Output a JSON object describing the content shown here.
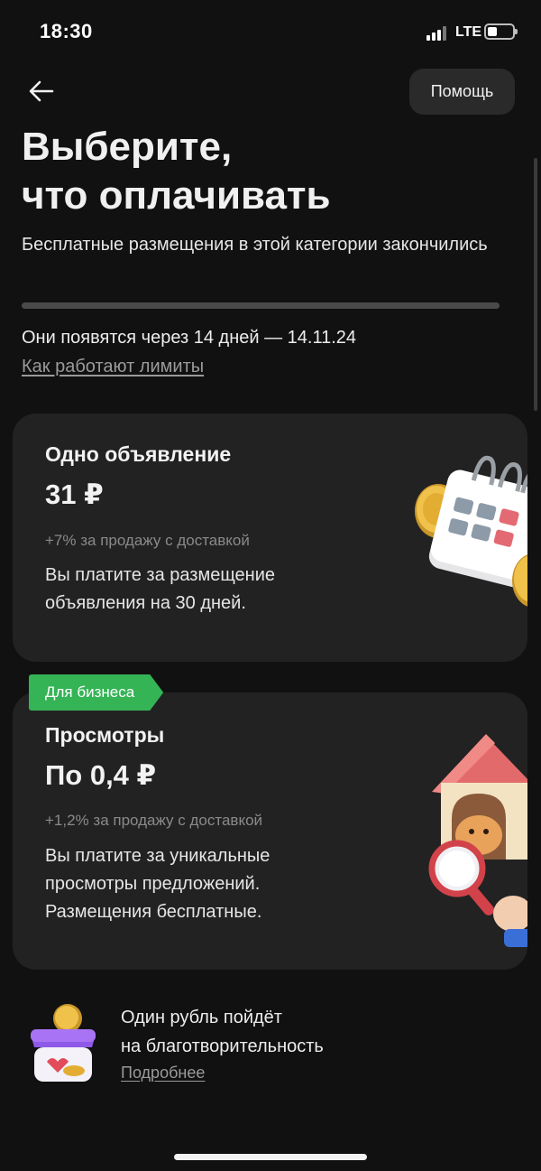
{
  "status_bar": {
    "time": "18:30",
    "network": "LTE",
    "battery_level": 0.3
  },
  "header": {
    "back_icon": "arrow-left-icon",
    "help_label": "Помощь"
  },
  "title": {
    "line1": "Выберите,",
    "line2": "что оплачивать"
  },
  "subtitle": "Бесплатные размещения в этой категории закончились",
  "limits": {
    "used_fraction": 1.0,
    "reset_text": "Они появятся через 14 дней — 14.11.24",
    "link_label": "Как работают лимиты"
  },
  "options": [
    {
      "title": "Одно объявление",
      "price": "31 ₽",
      "fee": "+7% за продажу с доставкой",
      "description": "Вы платите за размещение объявления на 30 дней.",
      "illustration": "calendar-coins-icon"
    },
    {
      "badge": "Для бизнеса",
      "title": "Просмотры",
      "price": "По 0,4 ₽",
      "fee": "+1,2% за продажу с доставкой",
      "description": "Вы платите за уникальные просмотры предложений. Размещения бесплатные.",
      "illustration": "doghouse-magnifier-icon"
    }
  ],
  "charity": {
    "line1": "Один рубль пойдёт",
    "line2": "на благотворительность",
    "link_label": "Подробнее",
    "illustration": "donation-box-icon"
  },
  "colors": {
    "background": "#111111",
    "card": "#222222",
    "badge_green": "#35b456",
    "muted_text": "#8a8a8a"
  }
}
